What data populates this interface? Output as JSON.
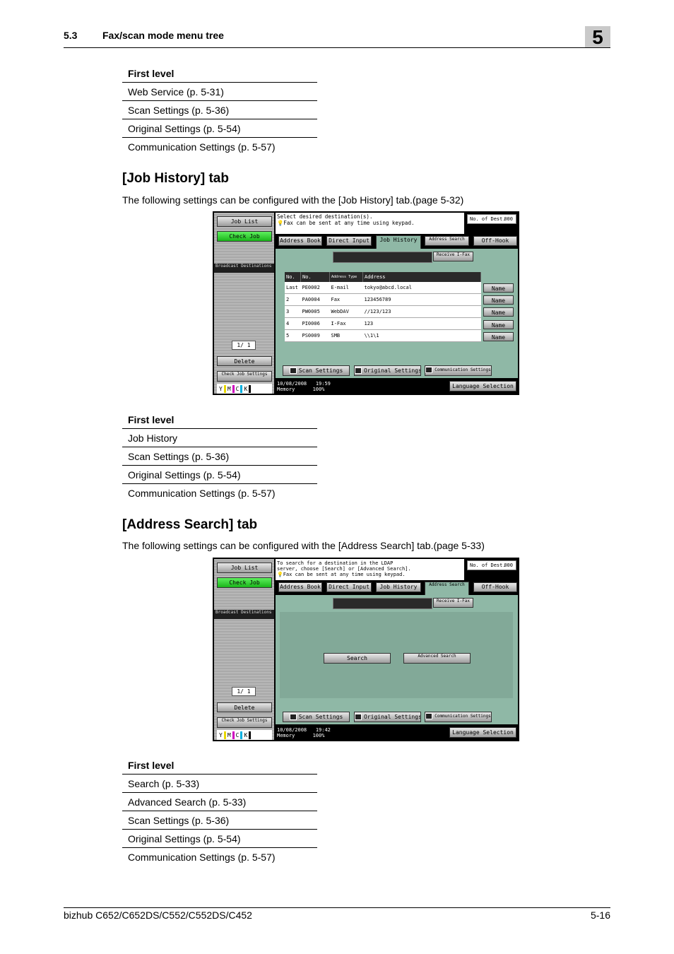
{
  "header": {
    "section_number": "5.3",
    "section_title": "Fax/scan mode menu tree",
    "chapter": "5"
  },
  "table1": {
    "header": "First level",
    "rows": [
      "Web Service (p. 5-31)",
      "Scan Settings (p. 5-36)",
      "Original Settings (p. 5-54)",
      "Communication Settings (p. 5-57)"
    ]
  },
  "job_history": {
    "heading": "[Job History] tab",
    "description": "The following settings can be configured with the [Job History] tab.(page 5-32)",
    "screen": {
      "left_buttons": {
        "job_list": "Job List",
        "check_job": "Check Job",
        "broadcast": "Broadcast Destinations",
        "counter": "1/  1",
        "delete": "Delete",
        "check_job_settings": "Check Job Settings"
      },
      "message": [
        "Select desired destination(s).",
        "Fax can be sent at any time using keypad."
      ],
      "no_of_dest_label": "No. of Dest.",
      "no_of_dest_value": "000",
      "tabs": [
        "Address Book",
        "Direct Input",
        "Job History",
        "Address Search",
        "Off-Hook"
      ],
      "receive": "Receive I-Fax",
      "columns": [
        "No.",
        "No.",
        "Address Type",
        "Address"
      ],
      "rows": [
        {
          "n": "Last",
          "id": "PE0002",
          "type": "E-mail",
          "addr": "tokyo@abcd.local"
        },
        {
          "n": "2",
          "id": "PA0004",
          "type": "Fax",
          "addr": "123456789"
        },
        {
          "n": "3",
          "id": "PW0005",
          "type": "WebDAV",
          "addr": "//123/123"
        },
        {
          "n": "4",
          "id": "PI0006",
          "type": "I-Fax",
          "addr": "123"
        },
        {
          "n": "5",
          "id": "PS0009",
          "type": "SMB",
          "addr": "\\\\1\\1"
        }
      ],
      "name_button": "Name",
      "bottom_buttons": [
        "Scan Settings",
        "Original Settings",
        "Communication Settings"
      ],
      "date": "10/08/2008",
      "time": "19:59",
      "memory_label": "Memory",
      "memory": "100%",
      "language": "Language Selection",
      "toner": [
        "Y",
        "M",
        "C",
        "K"
      ]
    }
  },
  "table2": {
    "header": "First level",
    "rows": [
      "Job History",
      "Scan Settings (p. 5-36)",
      "Original Settings (p. 5-54)",
      "Communication Settings (p. 5-57)"
    ]
  },
  "address_search": {
    "heading": "[Address Search] tab",
    "description": "The following settings can be configured with the [Address Search] tab.(page 5-33)",
    "screen": {
      "message": [
        "To search for a destination in the LDAP",
        "server, choose [Search] or [Advanced Search].",
        "Fax can be sent at any time using keypad."
      ],
      "search": "Search",
      "advanced_search": "Advanced Search",
      "date": "10/08/2008",
      "time": "19:42",
      "memory": "100%"
    }
  },
  "table3": {
    "header": "First level",
    "rows": [
      "Search (p. 5-33)",
      "Advanced Search (p. 5-33)",
      "Scan Settings (p. 5-36)",
      "Original Settings (p. 5-54)",
      "Communication Settings (p. 5-57)"
    ]
  },
  "footer": {
    "model": "bizhub C652/C652DS/C552/C552DS/C452",
    "page": "5-16"
  },
  "colors": {
    "panel_green": "#8fb8a6",
    "check_job_green": "#2fd52f",
    "header_bar": "#c9c9c9"
  }
}
